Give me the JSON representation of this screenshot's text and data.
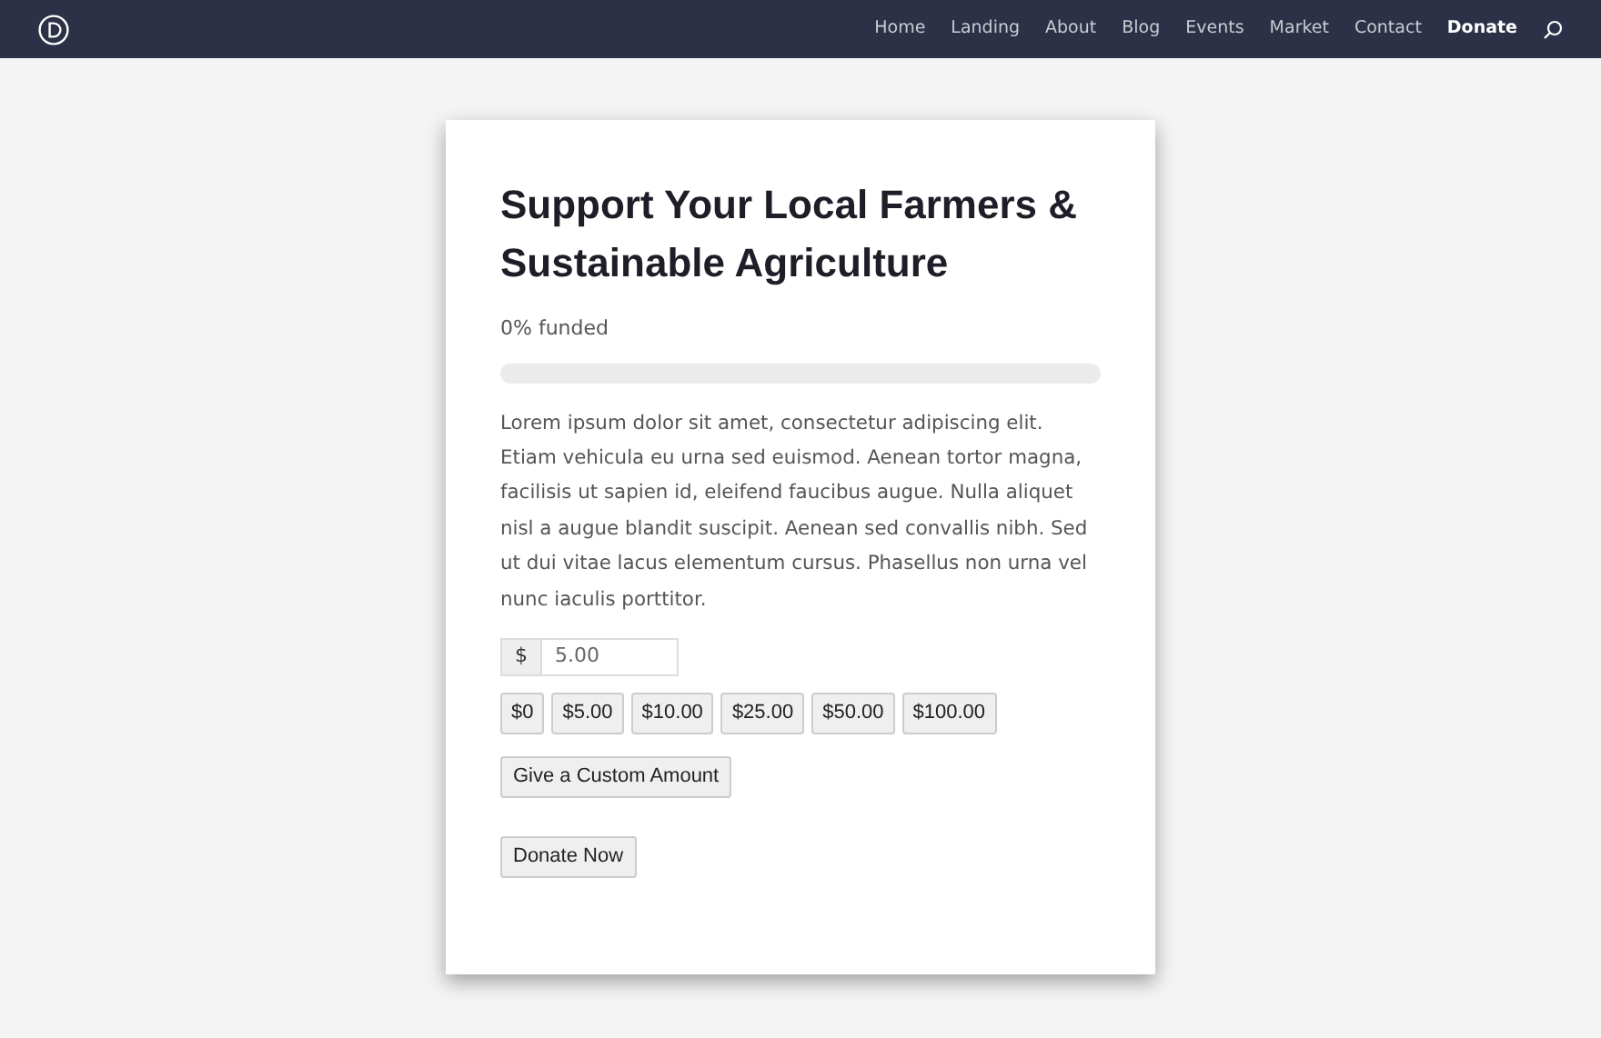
{
  "nav": {
    "items": [
      {
        "label": "Home",
        "selected": false
      },
      {
        "label": "Landing",
        "selected": false
      },
      {
        "label": "About",
        "selected": false
      },
      {
        "label": "Blog",
        "selected": false
      },
      {
        "label": "Events",
        "selected": false
      },
      {
        "label": "Market",
        "selected": false
      },
      {
        "label": "Contact",
        "selected": false
      },
      {
        "label": "Donate",
        "selected": true
      }
    ]
  },
  "campaign": {
    "title": "Support Your Local Farmers & Sustainable Agriculture",
    "funded": "0% funded",
    "level": 0,
    "description": "Lorem ipsum dolor sit amet, consectetur adipiscing elit. Etiam vehicula eu urna sed euismod. Aenean tortor magna, facilisis ut sapien id, eleifend faucibus augue. Nulla aliquet nisl a augue blandit suscipit. Aenean sed convallis nibh. Sed ut dui vitae lacus elementum cursus. Phasellus non urna vel nunc iaculis porttitor.",
    "currency": "$",
    "amount": "5.00",
    "presets": [
      "$0",
      "$5.00",
      "$10.00",
      "$25.00",
      "$50.00",
      "$100.00"
    ],
    "custom_button": "Give a Custom Amount",
    "donate_button": "Donate Now"
  }
}
